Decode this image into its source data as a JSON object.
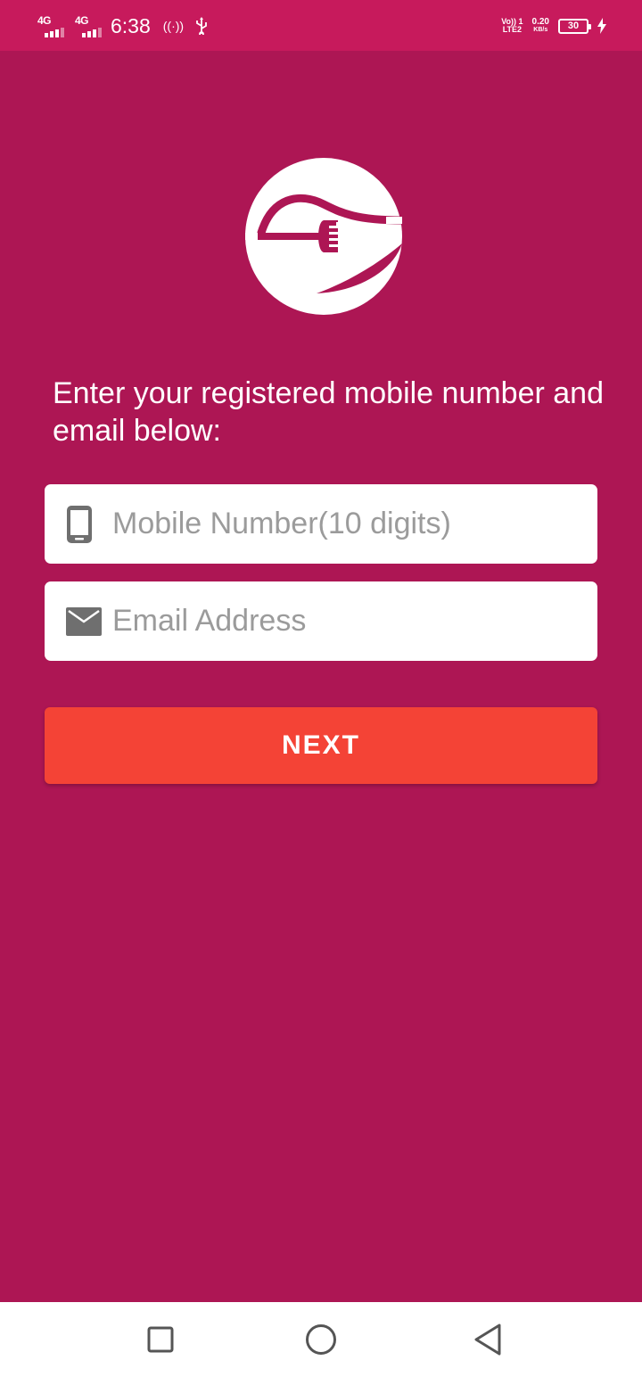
{
  "status_bar": {
    "sim1_network": "4G",
    "sim2_network": "4G",
    "time": "6:38",
    "hotspot": "((·))",
    "volte_line1": "Vo)) 1",
    "volte_line2": "LTE2",
    "speed_value": "0.20",
    "speed_unit": "KB/s",
    "battery_level": "30",
    "icons": [
      "signal-icon",
      "hotspot-icon",
      "usb-icon",
      "battery-icon",
      "charging-icon"
    ]
  },
  "logo": {
    "icon": "fork-plate-logo",
    "colors": {
      "circle": "#ffffff",
      "accent": "#ad1654"
    }
  },
  "form": {
    "prompt": "Enter your registered mobile number and email below:",
    "mobile": {
      "icon": "phone-icon",
      "placeholder": "Mobile Number(10 digits)",
      "value": ""
    },
    "email": {
      "icon": "mail-icon",
      "placeholder": "Email Address",
      "value": ""
    },
    "next_label": "NEXT"
  },
  "nav_bar": {
    "icons": [
      "recent-apps-icon",
      "home-icon",
      "back-icon"
    ]
  },
  "colors": {
    "background": "#ad1654",
    "status_bar": "#c71a5c",
    "button": "#f44336",
    "placeholder": "#9b9b9b"
  }
}
